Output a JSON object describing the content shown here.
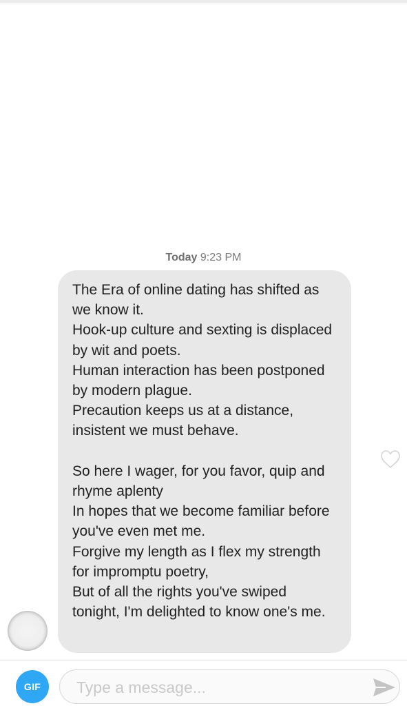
{
  "conversation": {
    "timestamp": {
      "day": "Today",
      "time": "9:23 PM"
    },
    "messages": [
      {
        "sender": "match",
        "text": "The Era of online dating has shifted as we know it.\nHook-up culture and sexting is displaced by wit and poets.\nHuman interaction has been postponed by modern plague.\nPrecaution keeps us at a distance, insistent we must behave.\n\nSo here I wager, for you favor, quip and rhyme aplenty\nIn hopes that we become familiar before you've even met me.\nForgive my length as I flex my strength for impromptu poetry,\nBut of all the rights you've swiped tonight, I'm delighted to know one's me.",
        "like_icon": "heart-outline-icon"
      }
    ]
  },
  "composer": {
    "gif_label": "GIF",
    "placeholder": "Type a message...",
    "value": "",
    "send_icon": "send-arrow-icon"
  },
  "colors": {
    "bubble_bg": "#e8e8e8",
    "gif_button": "#2ea7f5",
    "send_icon": "#c4c4c4"
  }
}
